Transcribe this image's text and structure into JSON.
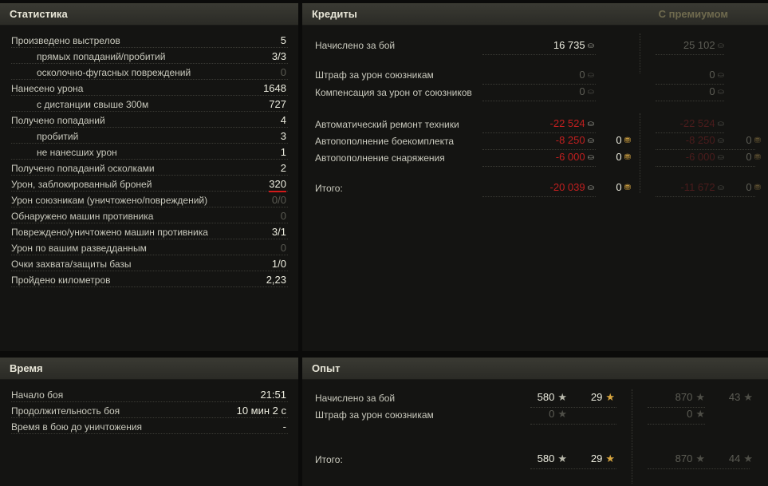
{
  "statistics": {
    "title": "Статистика",
    "rows": [
      {
        "label": "Произведено выстрелов",
        "value": "5",
        "indent": false
      },
      {
        "label": "прямых попаданий/пробитий",
        "value": "3/3",
        "indent": true
      },
      {
        "label": "осколочно-фугасных повреждений",
        "value": "0",
        "indent": true,
        "dim": true
      },
      {
        "label": "Нанесено урона",
        "value": "1648",
        "indent": false
      },
      {
        "label": "с дистанции свыше 300м",
        "value": "727",
        "indent": true
      },
      {
        "label": "Получено попаданий",
        "value": "4",
        "indent": false
      },
      {
        "label": "пробитий",
        "value": "3",
        "indent": true
      },
      {
        "label": "не нанесших урон",
        "value": "1",
        "indent": true
      },
      {
        "label": "Получено попаданий осколками",
        "value": "2",
        "indent": false
      },
      {
        "label": "Урон, заблокированный броней",
        "value": "320",
        "indent": false,
        "underline": true
      },
      {
        "label": "Урон союзникам (уничтожено/повреждений)",
        "value": "0/0",
        "indent": false,
        "dim": true
      },
      {
        "label": "Обнаружено машин противника",
        "value": "0",
        "indent": false,
        "dim": true
      },
      {
        "label": "Повреждено/уничтожено машин противника",
        "value": "3/1",
        "indent": false
      },
      {
        "label": "Урон по вашим разведданным",
        "value": "0",
        "indent": false,
        "dim": true
      },
      {
        "label": "Очки захвата/защиты базы",
        "value": "1/0",
        "indent": false
      },
      {
        "label": "Пройдено километров",
        "value": "2,23",
        "indent": false
      }
    ]
  },
  "time": {
    "title": "Время",
    "rows": [
      {
        "label": "Начало боя",
        "value": "21:51"
      },
      {
        "label": "Продолжительность боя",
        "value": "10 мин 2 с"
      },
      {
        "label": "Время в бою до уничтожения",
        "value": "-"
      }
    ]
  },
  "credits": {
    "title": "Кредиты",
    "premium_label": "С премиумом",
    "earned": {
      "label": "Начислено за бой",
      "value": "16 735",
      "premium": "25 102"
    },
    "penalty": {
      "label": "Штраф за урон союзникам",
      "value": "0",
      "premium": "0"
    },
    "compensation": {
      "label": "Компенсация за урон от союзников",
      "value": "0",
      "premium": "0"
    },
    "repair": {
      "label": "Автоматический ремонт техники",
      "value": "-22 524",
      "premium": "-22 524"
    },
    "ammo": {
      "label": "Автопополнение боекомплекта",
      "value": "-8 250",
      "gold": "0",
      "premium": "-8 250",
      "premium_gold": "0"
    },
    "equipment": {
      "label": "Автопополнение снаряжения",
      "value": "-6 000",
      "gold": "0",
      "premium": "-6 000",
      "premium_gold": "0"
    },
    "total": {
      "label": "Итого:",
      "value": "-20 039",
      "gold": "0",
      "premium": "-11 672",
      "premium_gold": "0"
    }
  },
  "experience": {
    "title": "Опыт",
    "earned": {
      "label": "Начислено за бой",
      "xp": "580",
      "free": "29",
      "premium_xp": "870",
      "premium_free": "43"
    },
    "penalty": {
      "label": "Штраф за урон союзникам",
      "xp": "0",
      "premium_xp": "0"
    },
    "total": {
      "label": "Итого:",
      "xp": "580",
      "free": "29",
      "premium_xp": "870",
      "premium_free": "44"
    }
  },
  "icons": {
    "credit": "credit-coin-icon",
    "gold": "gold-coin-icon",
    "xp": "xp-star-icon",
    "free_xp": "free-xp-star-icon"
  },
  "colors": {
    "negative": "#c21f1f",
    "underline": "#d21a1a",
    "gold": "#d8a640",
    "header": "#3a3a33"
  }
}
